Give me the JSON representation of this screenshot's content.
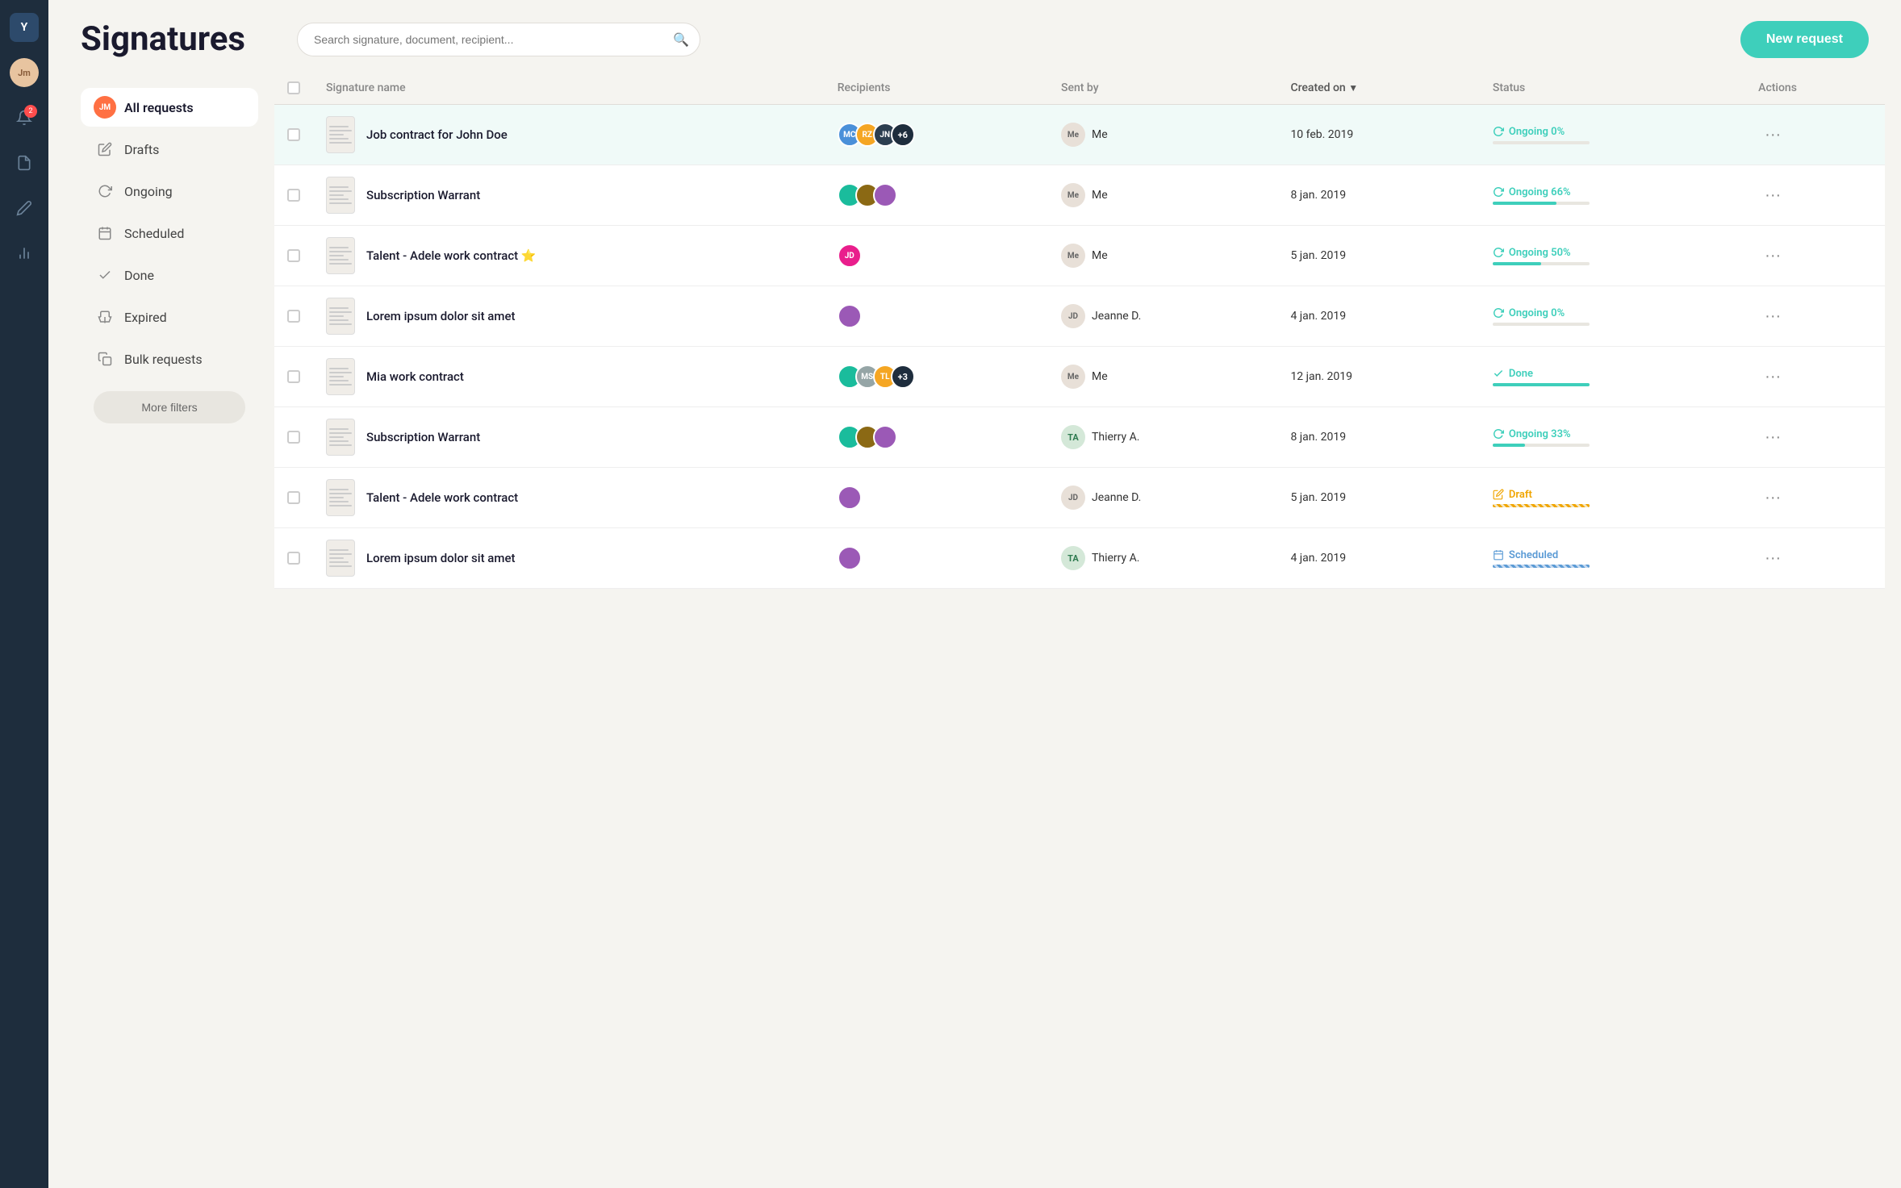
{
  "app": {
    "logo": "Y",
    "user_initials": "Jm"
  },
  "header": {
    "title": "Signatures",
    "search_placeholder": "Search signature, document, recipient...",
    "new_request_label": "New request"
  },
  "sidebar": {
    "items": [
      {
        "id": "all-requests",
        "label": "All requests",
        "icon": "avatar",
        "active": true
      },
      {
        "id": "drafts",
        "label": "Drafts",
        "icon": "edit"
      },
      {
        "id": "ongoing",
        "label": "Ongoing",
        "icon": "refresh"
      },
      {
        "id": "scheduled",
        "label": "Scheduled",
        "icon": "calendar"
      },
      {
        "id": "done",
        "label": "Done",
        "icon": "check"
      },
      {
        "id": "expired",
        "label": "Expired",
        "icon": "hourglass"
      },
      {
        "id": "bulk-requests",
        "label": "Bulk requests",
        "icon": "copy"
      }
    ],
    "more_filters_label": "More filters"
  },
  "table": {
    "columns": [
      {
        "id": "name",
        "label": "Signature name"
      },
      {
        "id": "recipients",
        "label": "Recipients"
      },
      {
        "id": "sent_by",
        "label": "Sent by"
      },
      {
        "id": "created_on",
        "label": "Created on",
        "sortable": true
      },
      {
        "id": "status",
        "label": "Status"
      },
      {
        "id": "actions",
        "label": "Actions"
      }
    ],
    "rows": [
      {
        "id": 1,
        "name": "Job contract for John Doe",
        "highlighted": true,
        "recipients_count": "+6",
        "sent_by_name": "Me",
        "created_on": "10 feb. 2019",
        "status_type": "ongoing",
        "status_label": "Ongoing",
        "status_pct": "0%",
        "progress": 0
      },
      {
        "id": 2,
        "name": "Subscription Warrant",
        "highlighted": false,
        "recipients_count": null,
        "sent_by_name": "Me",
        "created_on": "8 jan. 2019",
        "status_type": "ongoing",
        "status_label": "Ongoing",
        "status_pct": "66%",
        "progress": 66
      },
      {
        "id": 3,
        "name": "Talent - Adele work contract ⭐",
        "highlighted": false,
        "recipients_count": null,
        "sent_by_name": "Me",
        "created_on": "5 jan. 2019",
        "status_type": "ongoing",
        "status_label": "Ongoing",
        "status_pct": "50%",
        "progress": 50
      },
      {
        "id": 4,
        "name": "Lorem ipsum dolor sit amet",
        "highlighted": false,
        "recipients_count": null,
        "sent_by_name": "Jeanne D.",
        "created_on": "4 jan. 2019",
        "status_type": "ongoing",
        "status_label": "Ongoing",
        "status_pct": "0%",
        "progress": 0
      },
      {
        "id": 5,
        "name": "Mia work contract",
        "highlighted": false,
        "recipients_count": "+3",
        "sent_by_name": "Me",
        "created_on": "12 jan. 2019",
        "status_type": "done",
        "status_label": "Done",
        "status_pct": "",
        "progress": 100
      },
      {
        "id": 6,
        "name": "Subscription Warrant",
        "highlighted": false,
        "recipients_count": null,
        "sent_by_name": "Thierry A.",
        "created_on": "8 jan. 2019",
        "status_type": "ongoing",
        "status_label": "Ongoing",
        "status_pct": "33%",
        "progress": 33
      },
      {
        "id": 7,
        "name": "Talent - Adele work contract",
        "highlighted": false,
        "recipients_count": null,
        "sent_by_name": "Jeanne D.",
        "created_on": "5 jan. 2019",
        "status_type": "draft",
        "status_label": "Draft",
        "status_pct": "",
        "progress": 0
      },
      {
        "id": 8,
        "name": "Lorem ipsum dolor sit amet",
        "highlighted": false,
        "recipients_count": null,
        "sent_by_name": "Thierry A.",
        "created_on": "4 jan. 2019",
        "status_type": "scheduled",
        "status_label": "Scheduled",
        "status_pct": "",
        "progress": 0
      }
    ]
  }
}
